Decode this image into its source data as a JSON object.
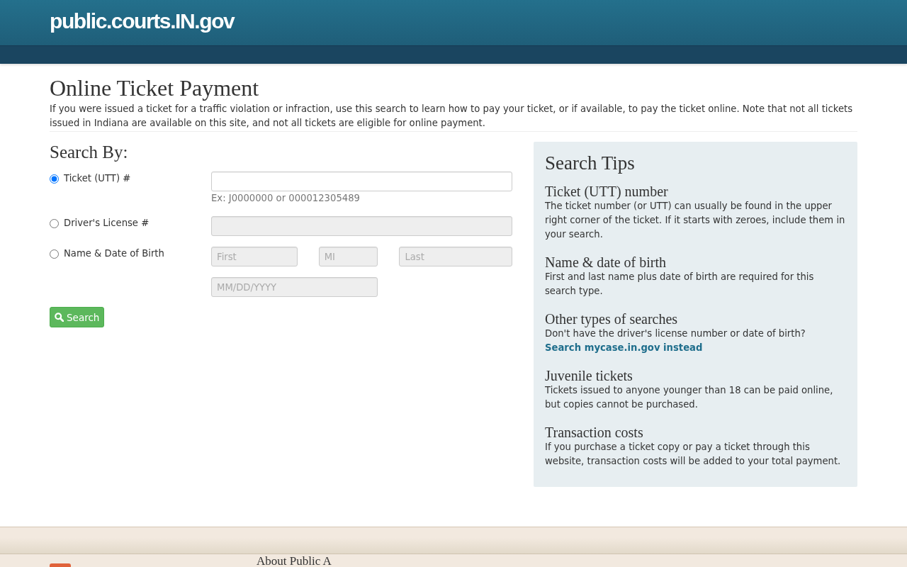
{
  "header": {
    "site_title": "public.courts.IN.gov"
  },
  "page": {
    "title": "Online Ticket Payment",
    "intro": "If you were issued a ticket for a traffic violation or infraction, use this search to learn how to pay your ticket, or if available, to pay the ticket online. Note that not all tickets issued in Indiana are available on this site, and not all tickets are eligible for online payment."
  },
  "search_by": {
    "heading": "Search By:",
    "options": [
      {
        "label": "Ticket (UTT) #",
        "selected": true,
        "fields": [
          {
            "kind": "ticket",
            "disabled": false
          }
        ],
        "help": "Ex: J0000000 or 000012305489"
      },
      {
        "label": "Driver's License #",
        "selected": false,
        "fields": [
          {
            "kind": "license",
            "disabled": true
          }
        ]
      },
      {
        "label": "Name & Date of Birth",
        "selected": false,
        "fields": [
          {
            "kind": "first_name",
            "placeholder": "First",
            "disabled": true
          },
          {
            "kind": "middle_initial",
            "placeholder": "MI",
            "disabled": true
          },
          {
            "kind": "last_name",
            "placeholder": "Last",
            "disabled": true
          },
          {
            "kind": "birth_date",
            "placeholder": "MM/DD/YYYY",
            "disabled": true
          }
        ]
      }
    ],
    "button": "Search"
  },
  "search_tips": {
    "title": "Search Tips",
    "tips": [
      {
        "heading": "Ticket (UTT) number",
        "text": "The ticket number (or UTT) can usually be found in the upper right corner of the ticket. If it starts with zeroes, include them in your search."
      },
      {
        "heading": "Name & date of birth",
        "text": "First and last name plus date of birth are required for this search type."
      },
      {
        "heading": "Other types of searches",
        "text": "Don't have the driver's license number or date of birth?",
        "link": "Search mycase.in.gov instead"
      },
      {
        "heading": "Juvenile tickets",
        "text": "Tickets issued to anyone younger than 18 can be paid online, but copies cannot be purchased."
      },
      {
        "heading": "Transaction costs",
        "text": "If you purchase a ticket copy or pay a ticket through this website, transaction costs will be added to your total payment."
      }
    ]
  },
  "footer": {
    "heading": "About Public A"
  }
}
